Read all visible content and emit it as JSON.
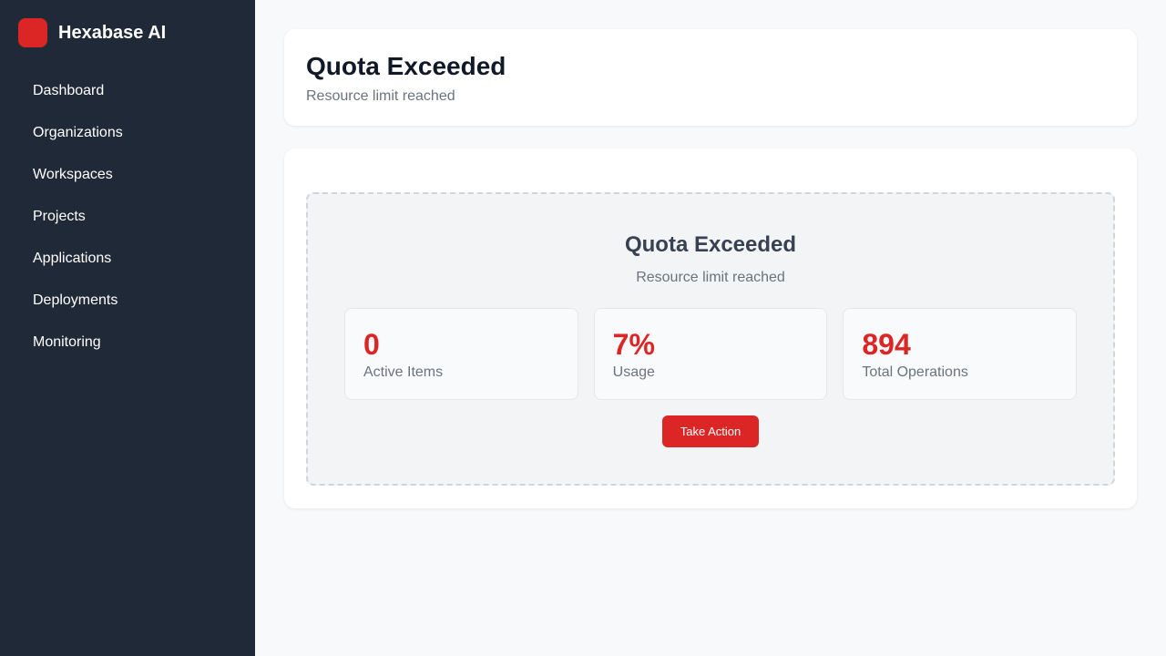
{
  "app": {
    "name": "Hexabase AI",
    "brand_color": "#dc2626"
  },
  "sidebar": {
    "items": [
      {
        "label": "Dashboard"
      },
      {
        "label": "Organizations"
      },
      {
        "label": "Workspaces"
      },
      {
        "label": "Projects"
      },
      {
        "label": "Applications"
      },
      {
        "label": "Deployments"
      },
      {
        "label": "Monitoring"
      }
    ]
  },
  "header": {
    "title": "Quota Exceeded",
    "subtitle": "Resource limit reached"
  },
  "panel": {
    "title": "Quota Exceeded",
    "subtitle": "Resource limit reached",
    "stats": [
      {
        "value": "0",
        "label": "Active Items"
      },
      {
        "value": "7%",
        "label": "Usage"
      },
      {
        "value": "894",
        "label": "Total Operations"
      }
    ],
    "action_label": "Take Action"
  }
}
